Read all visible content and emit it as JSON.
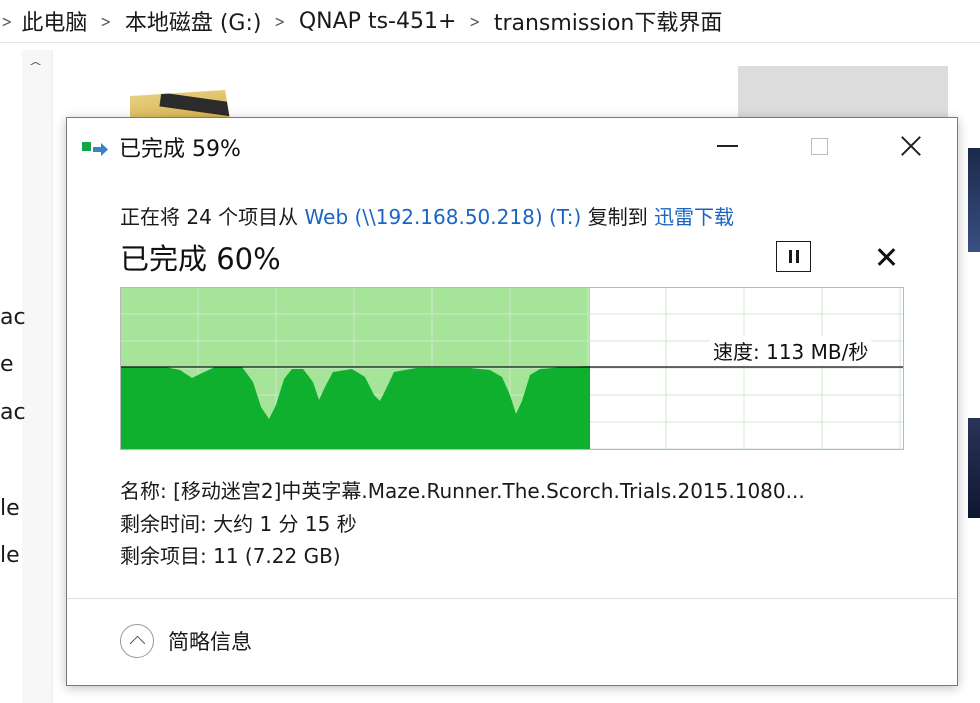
{
  "explorer": {
    "breadcrumb": [
      "此电脑",
      "本地磁盘 (G:)",
      "QNAP ts-451+",
      "transmission下载界面"
    ],
    "left_fragments": [
      "ac",
      "e",
      "ac",
      "le",
      "le"
    ]
  },
  "dialog": {
    "title": "已完成 59%",
    "description": {
      "prefix": "正在将 24 个项目从 ",
      "source": "Web (\\\\192.168.50.218) (T:)",
      "middle": " 复制到 ",
      "destination": "迅雷下载"
    },
    "progress_text": "已完成 60%",
    "progress_fraction": 0.6,
    "speed_label": "速度: 113 MB/秒",
    "name_line": "名称:  [移动迷宫2]中英字幕.Maze.Runner.The.Scorch.Trials.2015.1080...",
    "time_line": "剩余时间: 大约 1 分 15 秒",
    "items_line": "剩余项目: 11 (7.22 GB)",
    "details_toggle": "简略信息"
  },
  "colors": {
    "graph_light": "#a6e49a",
    "graph_dark": "#0eb02d",
    "link": "#1c64c4",
    "grid": "#cfe8cf"
  },
  "icons": [
    "chevron-right-icon",
    "chevron-up-icon",
    "copy-progress-icon",
    "minimize-icon",
    "maximize-icon",
    "close-icon",
    "pause-icon",
    "cancel-icon",
    "chevron-circle-up-icon"
  ]
}
